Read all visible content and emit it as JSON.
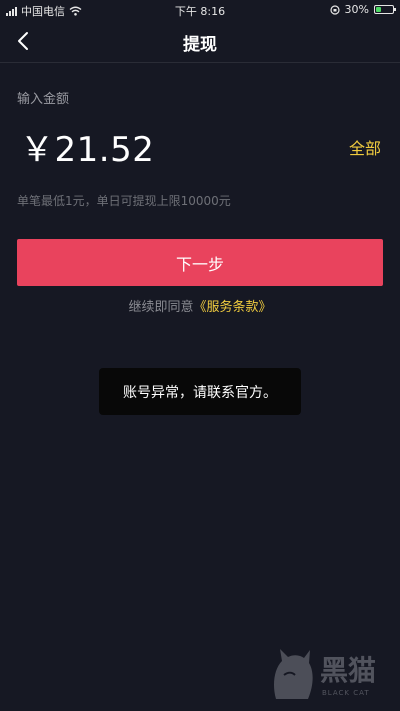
{
  "status_bar": {
    "carrier": "中国电信",
    "time": "下午 8:16",
    "battery": "30%",
    "battery_level": 0.3
  },
  "nav": {
    "title": "提现"
  },
  "withdraw": {
    "input_label": "输入金额",
    "amount": "￥21.52",
    "all_label": "全部",
    "limit_hint": "单笔最低1元，单日可提现上限10000元",
    "next_button": "下一步",
    "terms_prefix": "继续即同意",
    "terms_link": "《服务条款》"
  },
  "toast": {
    "message": "账号异常，请联系官方。"
  },
  "watermark": {
    "text": "黑猫",
    "subtext": "BLACK CAT"
  },
  "colors": {
    "background": "#161823",
    "accent_button": "#e9435d",
    "link_yellow": "#f1cc3f"
  }
}
